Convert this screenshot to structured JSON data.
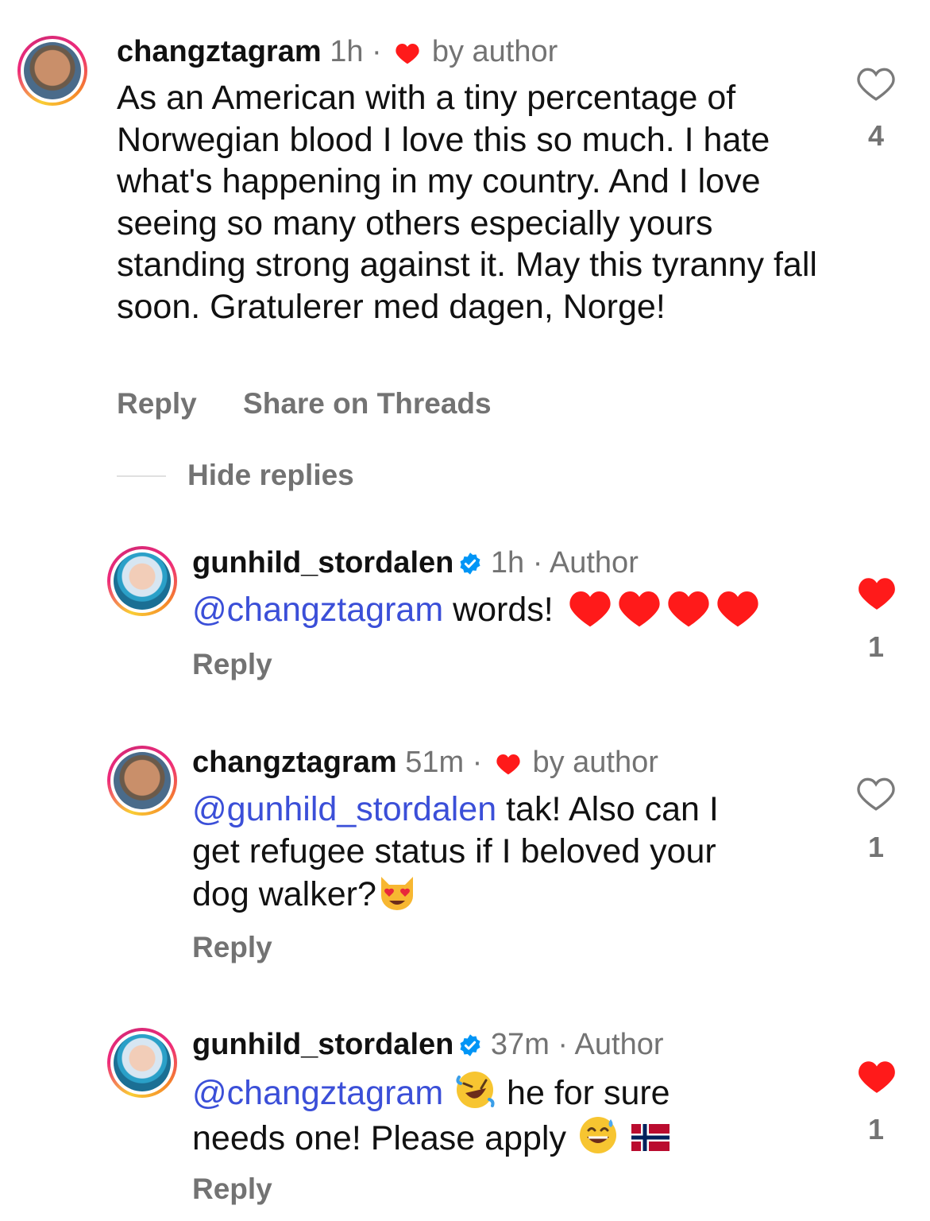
{
  "comments": [
    {
      "username": "changztagram",
      "time": "1h",
      "separator": "·",
      "tag": "by author",
      "text": "As an American with a tiny percentage of Norwegian blood I love this so much. I hate what's happening in my country. And I love seeing so many others especially yours standing strong against it. May this tyranny fall soon. Gratulerer med dagen, Norge!",
      "actions": [
        "Reply",
        "Share on Threads"
      ],
      "likes": "4",
      "liked": false
    },
    {
      "username": "gunhild_stordalen",
      "verified": true,
      "time": "1h",
      "separator": "·",
      "tag": "Author",
      "mention": "@changztagram",
      "text": "words!",
      "emojis": [
        "red-heart",
        "red-heart",
        "red-heart",
        "red-heart"
      ],
      "actions": [
        "Reply"
      ],
      "likes": "1",
      "liked": true
    },
    {
      "username": "changztagram",
      "time": "51m",
      "separator": "·",
      "tag": "by author",
      "mention": "@gunhild_stordalen",
      "text_line1": "tak! Also can I",
      "text_line2": "get refugee status if I beloved your",
      "text_line3": "dog walker?",
      "emojis": [
        "heart-eyes-cat"
      ],
      "actions": [
        "Reply"
      ],
      "likes": "1",
      "liked": false
    },
    {
      "username": "gunhild_stordalen",
      "verified": true,
      "time": "37m",
      "separator": "·",
      "tag": "Author",
      "mention": "@changztagram",
      "text_line1": "he for sure",
      "text_line2": "needs one! Please apply",
      "emojis": [
        "rolling-laughing",
        "grinning-sweat",
        "norway-flag"
      ],
      "actions": [
        "Reply"
      ],
      "likes": "1",
      "liked": true
    }
  ],
  "hide_replies": "Hide replies",
  "colors": {
    "mention": "#3b4fd8",
    "heart": "#ff0000",
    "meta": "#737373",
    "verified": "#0095f6"
  }
}
